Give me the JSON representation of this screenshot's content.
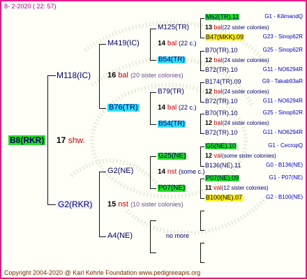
{
  "header": "8-  2-2020 ( 22: 57)",
  "footer": "Copyright 2004-2020 @ Karl Kehrle Foundation    www.pedigreeapis.org",
  "colors": {
    "border": "#e8178a",
    "green": "#22dd22",
    "cyan": "#33ddff",
    "yellow": "#ffee00"
  },
  "root": {
    "name": "B8(RKR)",
    "gen": "17",
    "text": "shw."
  },
  "gen1": [
    {
      "name": "M118(IC)",
      "gen": "16",
      "mark": "bal",
      "text": "(20 sister colonies)"
    },
    {
      "name": "G2(RKR)",
      "gen": "15",
      "mark": "nst",
      "text": "(10 sister colonies)"
    }
  ],
  "gen2": [
    {
      "name": "M419(IC)"
    },
    {
      "name": "B76(TR)"
    },
    {
      "name": "G2(NE)"
    },
    {
      "name": "A4(NE)",
      "note": "no more"
    }
  ],
  "gen3": [
    {
      "name": "M125(TR)",
      "gen": "14",
      "mark": "bal",
      "text": "(22 c.)"
    },
    {
      "name": "B54(TR)"
    },
    {
      "name": "B79(TR)",
      "gen": "14",
      "mark": "bal",
      "text": "(22 c.)"
    },
    {
      "name": "B54(TR)"
    },
    {
      "name": "G25(NE)",
      "gen": "14",
      "mark": "nst",
      "text": "(some c.)"
    },
    {
      "name": "P07(NE)"
    }
  ],
  "gen4": [
    {
      "name": "M62(TR).11",
      "right": "G1 - KilimandQ"
    },
    {
      "gen": "13",
      "mark": "bal",
      "text": "(22 sister colonies)"
    },
    {
      "name": "B47(MKK).09",
      "right": "G23 - Sinop62R"
    },
    {
      "name": "B70(TR).10",
      "right": "G25 - Sinop62R"
    },
    {
      "gen": "12",
      "mark": "bal",
      "text": "(24 sister colonies)"
    },
    {
      "name": "B72(TR).10",
      "right": "G11 - NO6294R"
    },
    {
      "name": "B174(TR).09",
      "right": "G9 - Takab93aR"
    },
    {
      "gen": "12",
      "mark": "bal",
      "text": "(24 sister colonies)"
    },
    {
      "name": "B72(TR).10",
      "right": "G11 - NO6294R"
    },
    {
      "name": "B70(TR).10",
      "right": "G25 - Sinop62R"
    },
    {
      "gen": "12",
      "mark": "bal",
      "text": "(24 sister colonies)"
    },
    {
      "name": "B72(TR).10",
      "right": "G11 - NO6294R"
    },
    {
      "name": "G5(NE).10",
      "right": "G1 - CecropQ"
    },
    {
      "gen": "12",
      "mark": "val",
      "text": "(some sister colonies)"
    },
    {
      "name": "B136(NE).11",
      "right": "G0 - B136(NE)"
    },
    {
      "name": "P07(NE).09",
      "right": "G1 - P07(NE)"
    },
    {
      "gen": "11",
      "mark": "val",
      "text": "(12 sister colonies)"
    },
    {
      "name": "B100(NE).07",
      "right": "G2 - B100(NE)"
    }
  ]
}
